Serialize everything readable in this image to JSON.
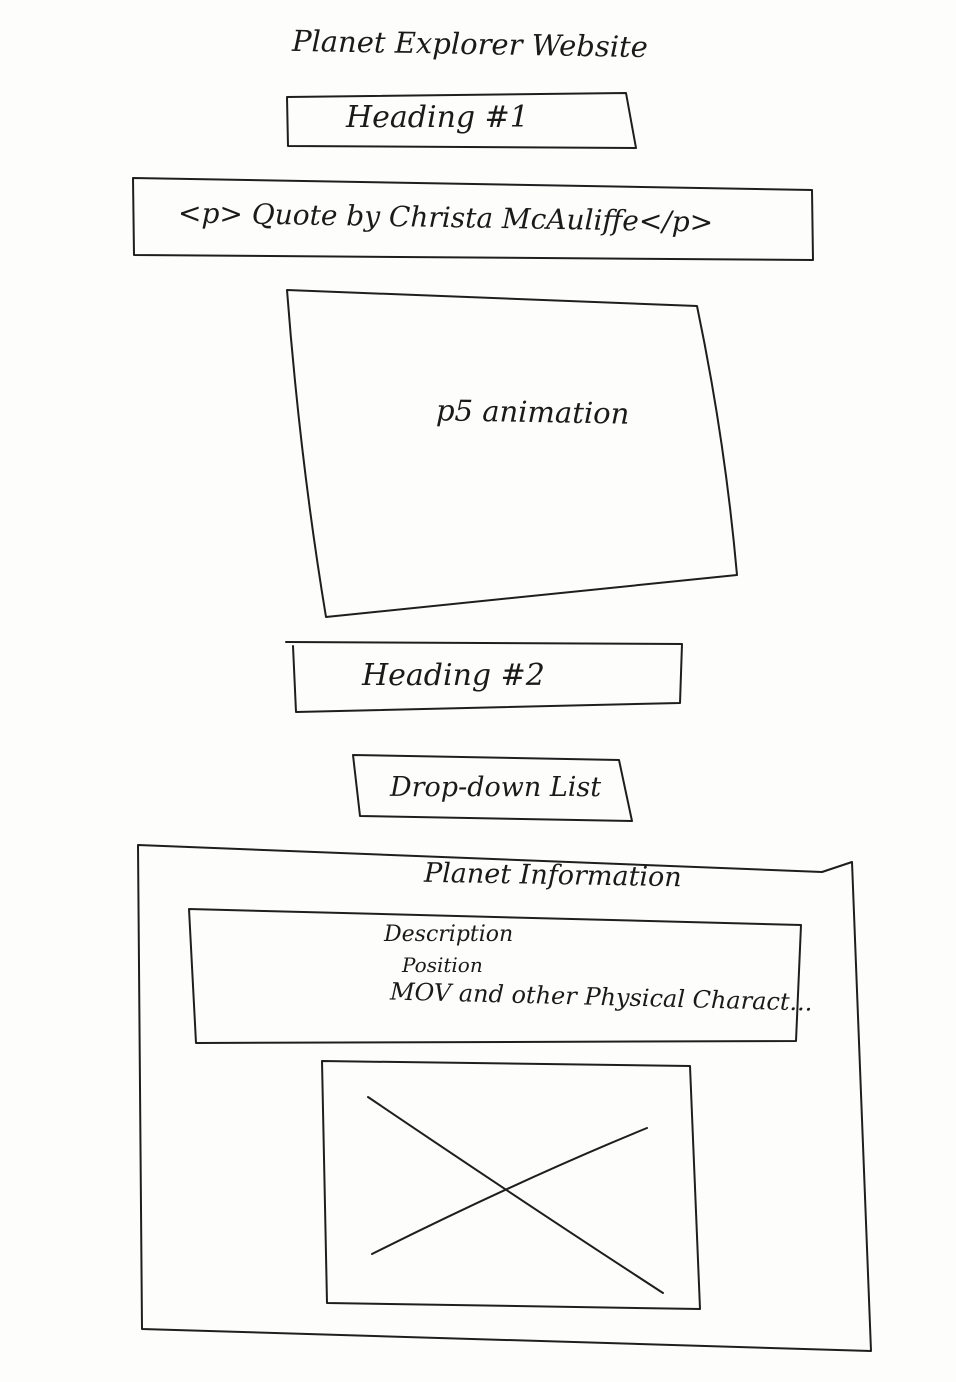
{
  "title": "Planet Explorer Website",
  "heading1": "Heading #1",
  "quote": "<p> Quote by Christa McAuliffe</p>",
  "animation_label": "p5 animation",
  "heading2": "Heading #2",
  "dropdown_label": "Drop-down List",
  "planet_info": {
    "title": "Planet Information",
    "details": {
      "description": "Description",
      "position": "Position",
      "mov": "MOV and other Physical Charact..."
    }
  }
}
